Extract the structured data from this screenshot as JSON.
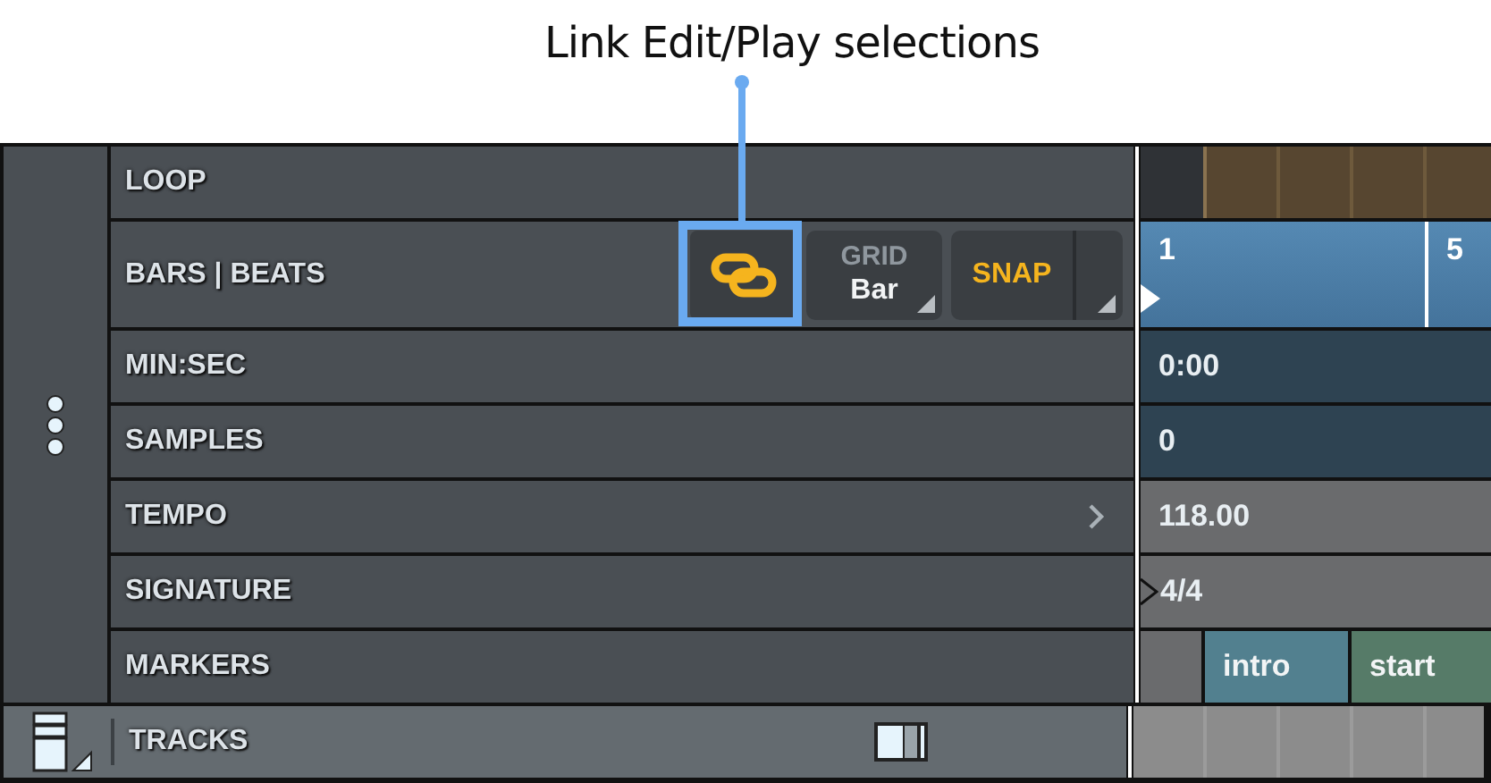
{
  "callout": {
    "text": "Link Edit/Play selections"
  },
  "rulers": [
    {
      "kind": "loop",
      "label": "LOOP"
    },
    {
      "kind": "bars",
      "label": "BARS | BEATS",
      "bars": [
        "1",
        "5"
      ]
    },
    {
      "kind": "time",
      "label": "MIN:SEC",
      "value": "0:00"
    },
    {
      "kind": "samples",
      "label": "SAMPLES",
      "value": "0"
    },
    {
      "kind": "tempo",
      "label": "TEMPO",
      "value": "118.00"
    },
    {
      "kind": "signature",
      "label": "SIGNATURE",
      "value": "4/4"
    },
    {
      "kind": "markers",
      "label": "MARKERS",
      "markers": [
        {
          "name": "intro",
          "color": "#52808f"
        },
        {
          "name": "start",
          "color": "#567b68"
        }
      ]
    }
  ],
  "link_button": {
    "on": true
  },
  "grid": {
    "label": "GRID",
    "value": "Bar"
  },
  "snap": {
    "label": "SNAP",
    "on": true
  },
  "tracks": {
    "label": "TRACKS"
  }
}
